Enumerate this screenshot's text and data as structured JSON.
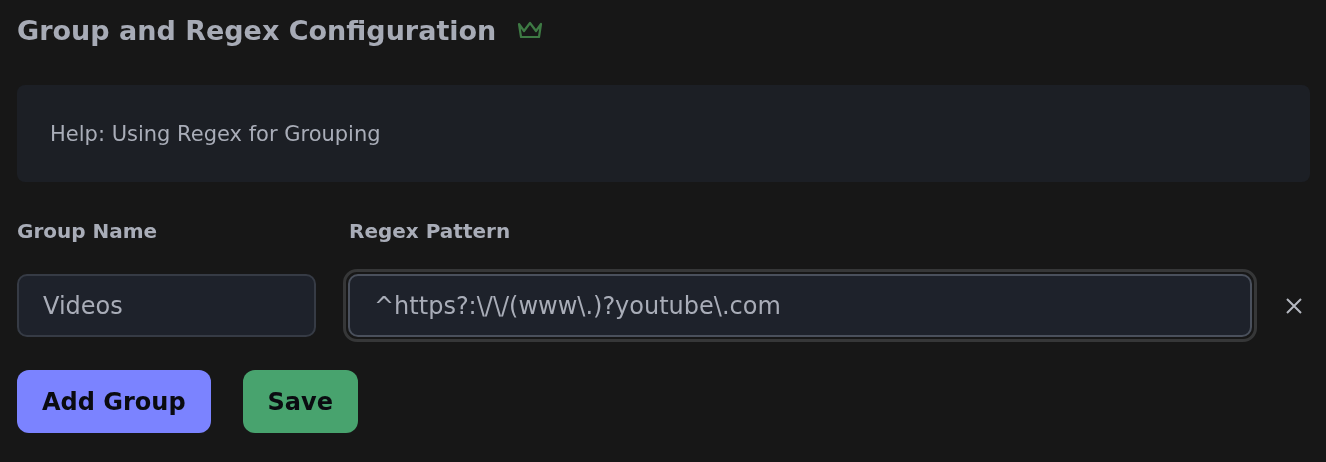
{
  "title": "Group and Regex Configuration",
  "help": {
    "label": "Help: Using Regex for Grouping"
  },
  "columns": [
    "Group Name",
    "Regex Pattern"
  ],
  "groups": [
    {
      "name": "Videos",
      "pattern": "^https?:\\/\\/(www\\.)?youtube\\.com",
      "focused": true
    }
  ],
  "buttons": [
    {
      "label": "Add Group",
      "kind": "primary"
    },
    {
      "label": "Save",
      "kind": "success"
    }
  ]
}
